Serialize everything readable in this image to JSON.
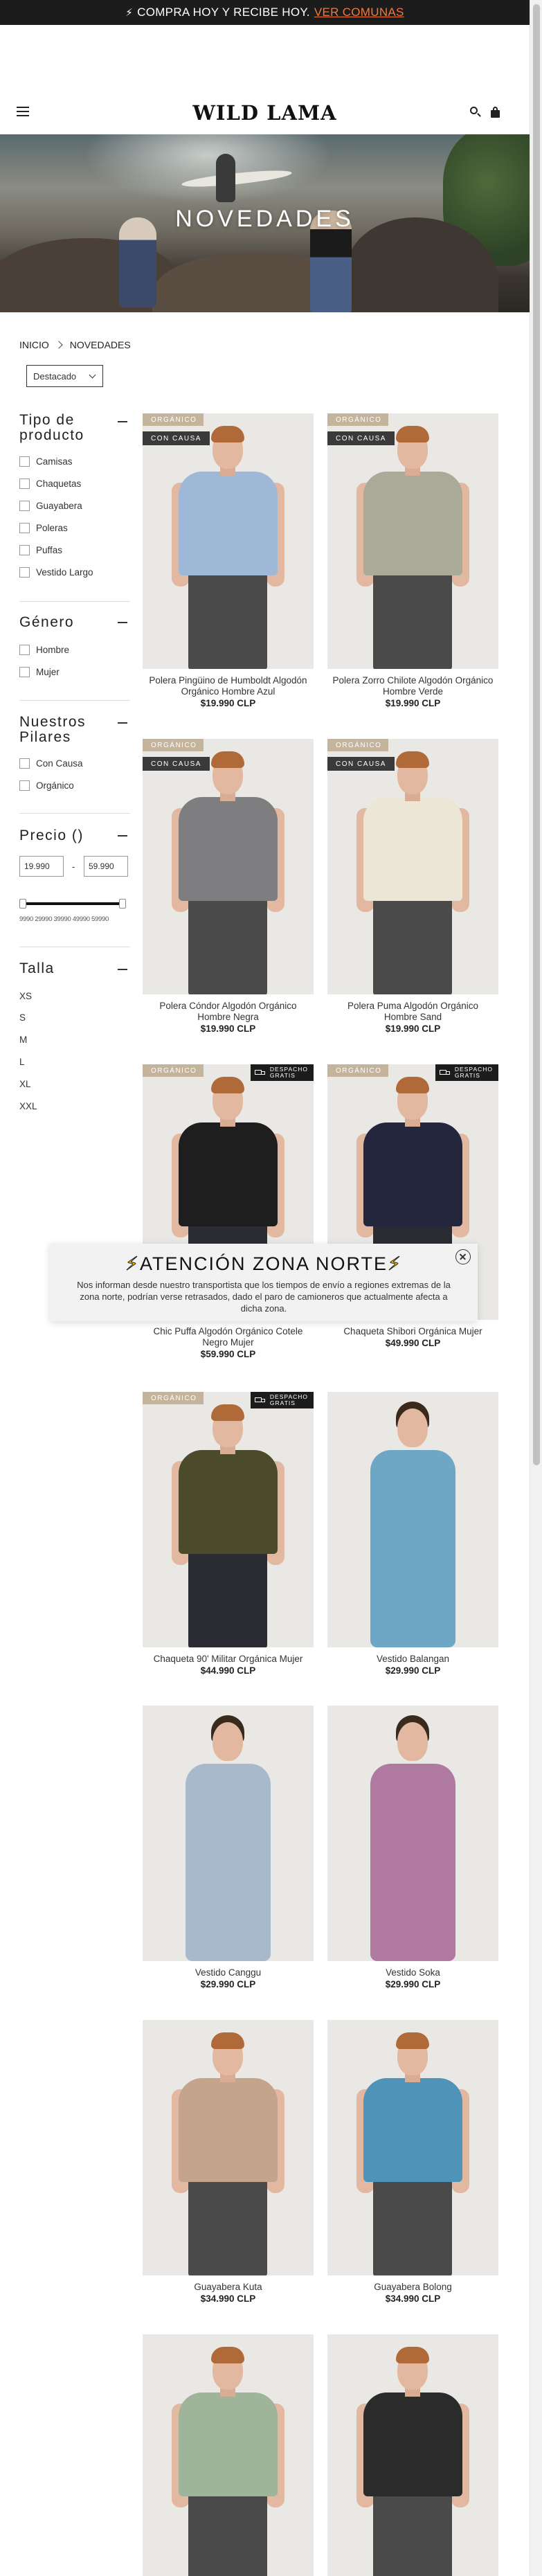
{
  "announcement": {
    "text": "COMPRA HOY Y RECIBE HOY.",
    "link": "VER COMUNAS",
    "icon": "bolt-icon"
  },
  "header": {
    "logo": "WILD LAMA",
    "icons": [
      "menu-icon",
      "search-icon",
      "bag-icon"
    ]
  },
  "hero": {
    "title": "NOVEDADES"
  },
  "breadcrumb": {
    "home": "INICIO",
    "current": "NOVEDADES"
  },
  "sort": {
    "selected": "Destacado"
  },
  "filters": {
    "product_type": {
      "title": "Tipo de producto",
      "options": [
        "Camisas",
        "Chaquetas",
        "Guayabera",
        "Poleras",
        "Puffas",
        "Vestido Largo"
      ]
    },
    "gender": {
      "title": "Género",
      "options": [
        "Hombre",
        "Mujer"
      ]
    },
    "pillars": {
      "title": "Nuestros Pilares",
      "options": [
        "Con Causa",
        "Orgánico"
      ]
    },
    "price": {
      "title": "Precio ()",
      "min": "19.990",
      "max": "59.990",
      "ticks": "9990 29990 39990 49990 59990",
      "range": [
        19990,
        59990
      ]
    },
    "size": {
      "title": "Talla",
      "options": [
        "XS",
        "S",
        "M",
        "L",
        "XL",
        "XXL"
      ]
    }
  },
  "badges": {
    "organic": "ORGÁNICO",
    "cause": "CON CAUSA",
    "shipping_line1": "DESPACHO",
    "shipping_line2": "GRATIS"
  },
  "products": [
    {
      "name": "Polera Pingüino de Humboldt Algodón Orgánico Hombre Azul",
      "price": "$19.990 CLP",
      "organic": true,
      "cause": true,
      "shipping": false,
      "color": "#9fb8d8"
    },
    {
      "name": "Polera Zorro Chilote Algodón Orgánico Hombre Verde",
      "price": "$19.990 CLP",
      "organic": true,
      "cause": true,
      "shipping": false,
      "color": "#a9ab98"
    },
    {
      "name": "Polera Cóndor Algodón Orgánico Hombre Negra",
      "price": "$19.990 CLP",
      "organic": true,
      "cause": true,
      "shipping": false,
      "color": "#7e7e80"
    },
    {
      "name": "Polera Puma Algodón Orgánico Hombre Sand",
      "price": "$19.990 CLP",
      "organic": true,
      "cause": true,
      "shipping": false,
      "color": "#ece6d6"
    },
    {
      "name": "Chic Puffa Algodón Orgánico Cotele Negro Mujer",
      "price": "$59.990 CLP",
      "organic": true,
      "cause": false,
      "shipping": true,
      "color": "#1e1e1e"
    },
    {
      "name": "Chaqueta Shibori Orgánica Mujer",
      "price": "$49.990 CLP",
      "organic": true,
      "cause": false,
      "shipping": true,
      "color": "#24263d"
    },
    {
      "name": "Chaqueta 90' Militar Orgánica Mujer",
      "price": "$44.990 CLP",
      "organic": true,
      "cause": false,
      "shipping": true,
      "color": "#4b4a2b"
    },
    {
      "name": "Vestido Balangan",
      "price": "$29.990 CLP",
      "organic": false,
      "cause": false,
      "shipping": false,
      "color": "#6ea7c6"
    },
    {
      "name": "Vestido Canggu",
      "price": "$29.990 CLP",
      "organic": false,
      "cause": false,
      "shipping": false,
      "color": "#a8b9cc"
    },
    {
      "name": "Vestido Soka",
      "price": "$29.990 CLP",
      "organic": false,
      "cause": false,
      "shipping": false,
      "color": "#b07aa0"
    },
    {
      "name": "Guayabera Kuta",
      "price": "$34.990 CLP",
      "organic": false,
      "cause": false,
      "shipping": false,
      "color": "#c4a48a"
    },
    {
      "name": "Guayabera Bolong",
      "price": "$34.990 CLP",
      "organic": false,
      "cause": false,
      "shipping": false,
      "color": "#4f93b8"
    },
    {
      "name": "",
      "price": "",
      "organic": false,
      "cause": false,
      "shipping": false,
      "color": "#9fb59a"
    },
    {
      "name": "",
      "price": "",
      "organic": false,
      "cause": false,
      "shipping": false,
      "color": "#2b2b2b"
    }
  ],
  "popup": {
    "title": "ATENCIÓN ZONA NORTE",
    "text": "Nos informan desde nuestro transportista que los tiempos de envío a regiones extremas de la zona norte, podrían verse retrasados, dado el paro de camioneros que actualmente afecta a dicha zona.",
    "icon": "lightning-icon"
  }
}
